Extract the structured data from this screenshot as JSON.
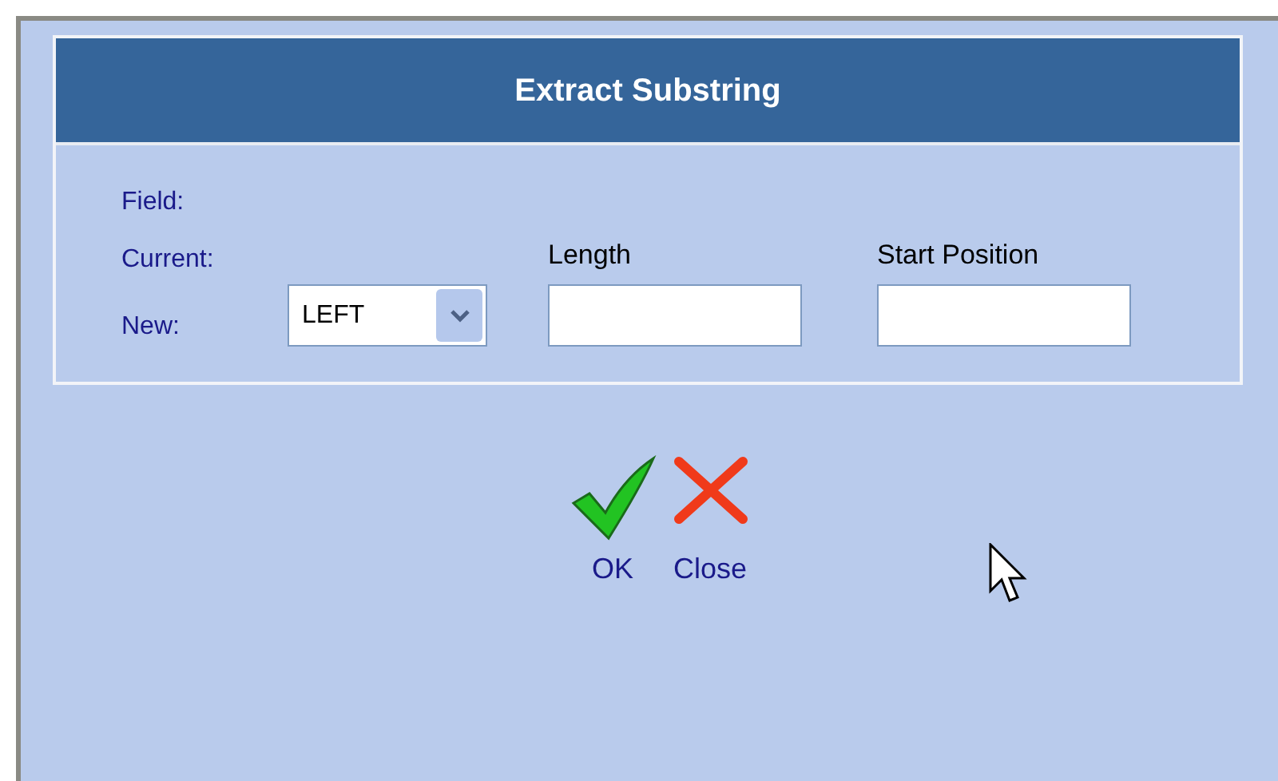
{
  "dialog": {
    "title": "Extract Substring"
  },
  "labels": [
    "Field:",
    "Current:",
    "New:"
  ],
  "function_select": {
    "value": "LEFT"
  },
  "inputs": [
    {
      "label": "Length"
    },
    {
      "label": "Start Position"
    }
  ],
  "buttons": [
    {
      "kind": "ok",
      "label": "OK"
    },
    {
      "kind": "close",
      "label": "Close"
    }
  ]
}
